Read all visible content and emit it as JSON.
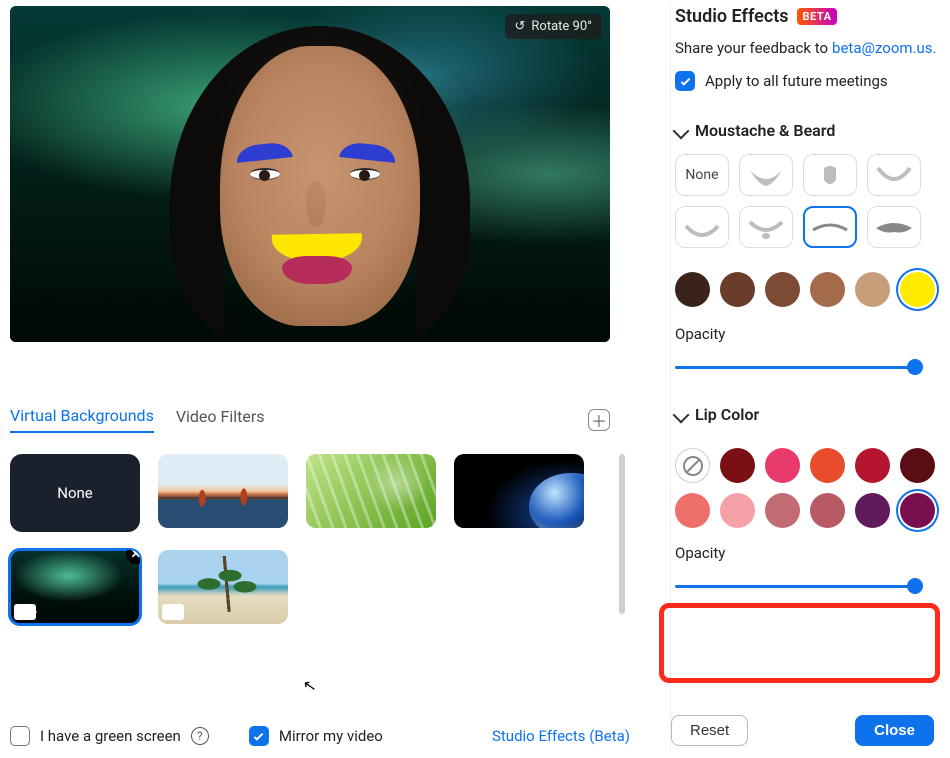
{
  "preview": {
    "rotate_label": "Rotate 90°"
  },
  "tabs": {
    "virtual_backgrounds": "Virtual Backgrounds",
    "video_filters": "Video Filters"
  },
  "backgrounds": {
    "none_label": "None"
  },
  "bottom": {
    "green_screen": "I have a green screen",
    "mirror": "Mirror my video",
    "studio_effects_link": "Studio Effects (Beta)"
  },
  "panel": {
    "title": "Studio Effects",
    "beta": "BETA",
    "share_text": "Share your feedback to",
    "share_email": "beta@zoom.us",
    "apply_all": "Apply to all future meetings",
    "moustache_beard": "Moustache & Beard",
    "none_label": "None",
    "opacity_label": "Opacity",
    "lip_color": "Lip Color",
    "reset": "Reset",
    "close": "Close"
  },
  "colors": {
    "beard": [
      "#3a2419",
      "#6a3c2a",
      "#7d4a35",
      "#a46a4c",
      "#c79e7a",
      "#ffeb00"
    ],
    "beard_selected": 5,
    "lip_row1": [
      "none",
      "#7a0f14",
      "#e83a6b",
      "#e84c2a",
      "#b6152f",
      "#5a0d12"
    ],
    "lip_row2": [
      "#ef6f6a",
      "#f4a2a8",
      "#c36b72",
      "#b85a63",
      "#611a5b",
      "#7a0f4f"
    ],
    "lip_selected_index": 11
  },
  "sliders": {
    "beard_opacity_pct": 100,
    "lip_opacity_pct": 100
  }
}
